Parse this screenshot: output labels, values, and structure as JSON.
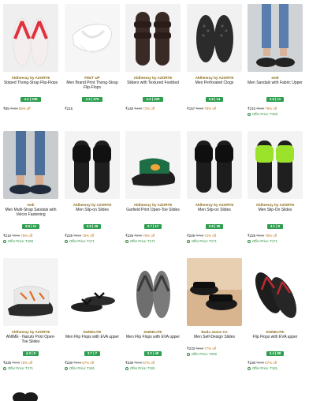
{
  "products": [
    {
      "brand": "Aldheeray by AZORTE",
      "name": "Striped Thong-Strap Flip-Flops",
      "rating": "4.4 | 236",
      "price": "₹55",
      "mrp": "₹499",
      "off": "89% off",
      "offer": ""
    },
    {
      "brand": "FEET UP",
      "name": "Men Brand Print Thong-Strap Flip-Flops",
      "rating": "4.3 | 376",
      "price": "₹215",
      "mrp": "",
      "off": "",
      "offer": ""
    },
    {
      "brand": "Aldheeray by AZORTE",
      "name": "Sliders with Textured Footbed",
      "rating": "4.3 | 230",
      "price": "₹140",
      "mrp": "₹499",
      "off": "72% off",
      "offer": ""
    },
    {
      "brand": "Aldheeray by AZORTE",
      "name": "Men Perforated Clogs",
      "rating": "3.8 | 14",
      "price": "₹157",
      "mrp": "₹699",
      "off": "78% off",
      "offer": ""
    },
    {
      "brand": "eedi",
      "name": "Men Sandals with Fabric Upper",
      "rating": "3.9 | 11",
      "price": "₹210",
      "mrp": "₹999",
      "off": "79% off",
      "offer": "Offer Price: ₹159"
    },
    {
      "brand": "eedi",
      "name": "Men Multi-Strap Sandals with Velcro Fastening",
      "rating": "3.9 | 11",
      "price": "₹210",
      "mrp": "₹999",
      "off": "79% off",
      "offer": "Offer Price: ₹159"
    },
    {
      "brand": "Aldheeray by AZORTE",
      "name": "Men Slip-on Slides",
      "rating": "3.9 | 26",
      "price": "₹225",
      "mrp": "₹899",
      "off": "75% off",
      "offer": "Offer Price: ₹171"
    },
    {
      "brand": "Aldheeray by AZORTE",
      "name": "Garfield Print Open-Toe Slides",
      "rating": "3.7 | 17",
      "price": "₹225",
      "mrp": "₹899",
      "off": "75% off",
      "offer": "Offer Price: ₹171"
    },
    {
      "brand": "Aldheeray by AZORTE",
      "name": "Men Slip-on Slides",
      "rating": "3.8 | 35",
      "price": "₹225",
      "mrp": "₹799",
      "off": "72% off",
      "offer": "Offer Price: ₹171"
    },
    {
      "brand": "Aldheeray by AZORTE",
      "name": "Men Slip-On Slides",
      "rating": "4.1 | 9",
      "price": "₹225",
      "mrp": "₹899",
      "off": "75% off",
      "offer": "Offer Price: ₹171"
    },
    {
      "brand": "Aldheeray by AZORTE",
      "name": "ANIME - Naruto Print Open-Toe Slides",
      "rating": "4.3 | 9",
      "price": "₹225",
      "mrp": "₹899",
      "off": "75% off",
      "offer": "Offer Price: ₹171"
    },
    {
      "brand": "DUNELITE",
      "name": "Men Flip Flops with EVA upper",
      "rating": "3.7 | 7",
      "price": "₹230",
      "mrp": "₹699",
      "off": "67% off",
      "offer": "Offer Price: ₹181"
    },
    {
      "brand": "DUNELITE",
      "name": "Men Flip Flops with EVA upper",
      "rating": "3.2 | 49",
      "price": "₹230",
      "mrp": "₹699",
      "off": "67% off",
      "offer": "Offer Price: ₹181"
    },
    {
      "brand": "Buda Jeans Co",
      "name": "Men Self-Design Slides",
      "rating": "",
      "price": "₹233",
      "mrp": "₹999",
      "off": "77% off",
      "offer": "Offer Price: ₹200"
    },
    {
      "brand": "DUNELITE",
      "name": "Flip Flops with EVA upper",
      "rating": "3.4 | 88",
      "price": "₹230",
      "mrp": "₹699",
      "off": "67% off",
      "offer": "Offer Price: ₹181"
    }
  ]
}
